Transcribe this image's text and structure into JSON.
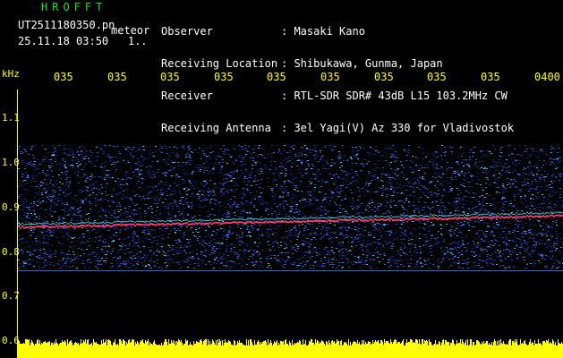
{
  "header": {
    "logo": "HROFFT",
    "filename": "UT2511180350.pn",
    "filename_suffix": "meteor",
    "datetime": "25.11.18 03:50",
    "counter": "1..",
    "info_labels": [
      "Observer",
      "Receiving Location",
      "Receiver",
      "Receiving Antenna"
    ],
    "info_values": [
      ": Masaki Kano",
      ": Shibukawa, Gunma, Japan",
      ": RTL-SDR SDR# 43dB L15 103.2MHz CW",
      ": 3el Yagi(V) Az 330 for Vladivostok"
    ]
  },
  "axes": {
    "freq_unit": "kHz",
    "freq_labels": [
      "1.1",
      "1.0",
      "0.9",
      "0.8",
      "0.7",
      "0.6"
    ],
    "time_labels": [
      "035",
      "035",
      "035",
      "035",
      "035",
      "035",
      "035",
      "035",
      "035",
      "0400"
    ]
  },
  "colors": {
    "background": "#000000",
    "axis_text": "#ffff00",
    "logo": "#22dd22",
    "noise_low": "#1030a0",
    "noise_mid": "#2a6ad8",
    "noise_high": "#3ccfd0",
    "signal": "#ff3a6a",
    "power_bar": "#ffff00"
  }
}
